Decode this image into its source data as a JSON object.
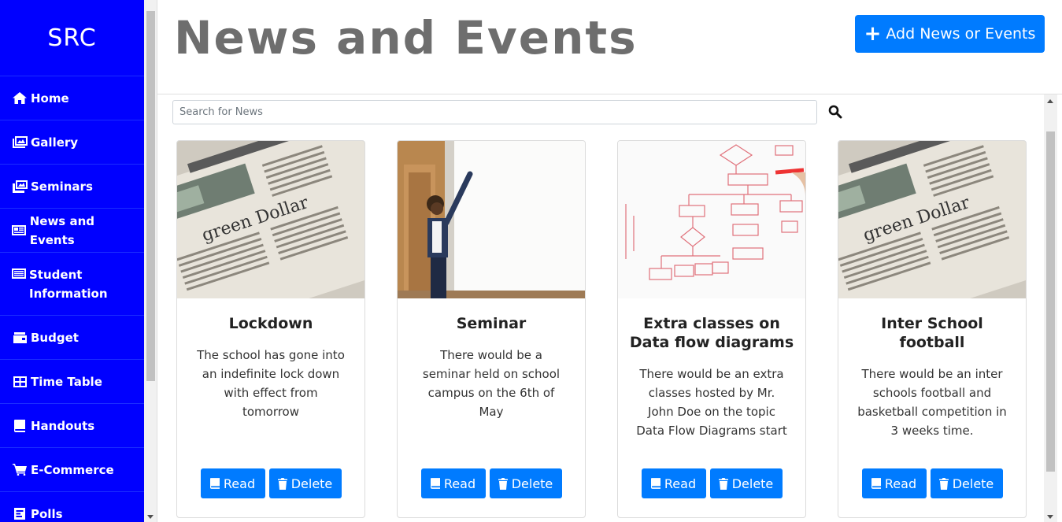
{
  "sidebar": {
    "brand": "SRC",
    "items": [
      {
        "label": "Home",
        "icon": "home-icon"
      },
      {
        "label": "Gallery",
        "icon": "gallery-icon"
      },
      {
        "label": "Seminars",
        "icon": "images-icon"
      },
      {
        "label": "News and Events",
        "icon": "newspaper-icon"
      },
      {
        "label": "Student Information",
        "icon": "list-icon"
      },
      {
        "label": "Budget",
        "icon": "wallet-icon"
      },
      {
        "label": "Time Table",
        "icon": "table-icon"
      },
      {
        "label": "Handouts",
        "icon": "book-icon"
      },
      {
        "label": "E-Commerce",
        "icon": "cart-icon"
      },
      {
        "label": "Polls",
        "icon": "poll-icon"
      }
    ]
  },
  "header": {
    "title": "News and Events",
    "add_button": "Add News or Events"
  },
  "search": {
    "placeholder": "Search for News",
    "value": ""
  },
  "cards": [
    {
      "title": "Lockdown",
      "text": "The school has gone into an indefinite lock down with effect from tomorrow",
      "image": "newspaper-photo",
      "read": "Read",
      "delete": "Delete"
    },
    {
      "title": "Seminar",
      "text": "There would be a seminar held on school campus on the 6th of May",
      "image": "whiteboard-presenter-photo",
      "read": "Read",
      "delete": "Delete"
    },
    {
      "title": "Extra classes on Data flow diagrams",
      "text": "There would be an extra classes hosted by Mr. John Doe on the topic Data Flow Diagrams start",
      "image": "flowchart-whiteboard-photo",
      "read": "Read",
      "delete": "Delete"
    },
    {
      "title": "Inter School football",
      "text": "There would be an inter schools football and basketball competition in 3 weeks time.",
      "image": "newspaper-photo",
      "read": "Read",
      "delete": "Delete"
    }
  ],
  "colors": {
    "sidebar_bg": "#0000ff",
    "primary": "#007bff",
    "title_text": "#6e6e6e"
  }
}
